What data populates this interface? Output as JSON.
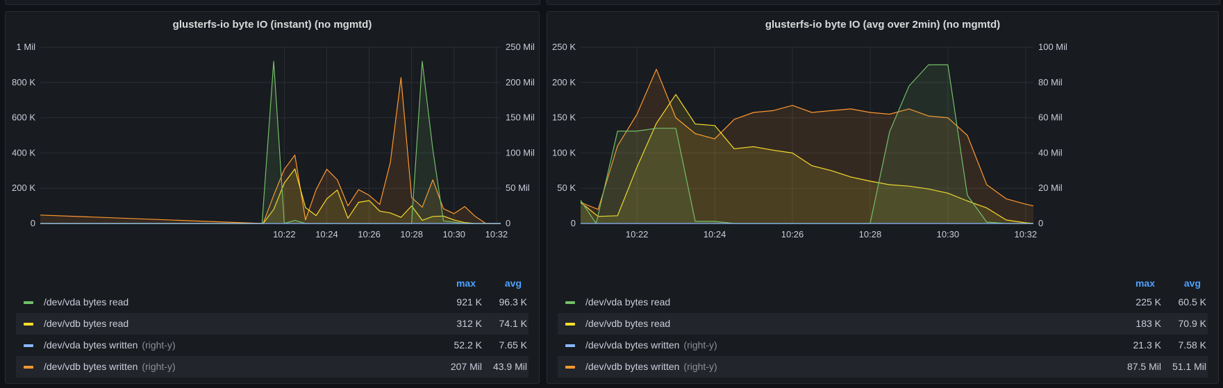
{
  "panels": [
    {
      "title": "glusterfs-io byte IO (instant) (no mgmtd)",
      "legend": {
        "max_header": "max",
        "avg_header": "avg",
        "rows": [
          {
            "name": "/dev/vda bytes read",
            "axis_note": "",
            "color": "#73bf69",
            "max": "921 K",
            "avg": "96.3 K"
          },
          {
            "name": "/dev/vdb bytes read",
            "axis_note": "",
            "color": "#fade2a",
            "max": "312 K",
            "avg": "74.1 K"
          },
          {
            "name": "/dev/vda bytes written",
            "axis_note": "(right-y)",
            "color": "#8ab8ff",
            "max": "52.2 K",
            "avg": "7.65 K"
          },
          {
            "name": "/dev/vdb bytes written",
            "axis_note": "(right-y)",
            "color": "#ff9830",
            "max": "207 Mil",
            "avg": "43.9 Mil"
          }
        ]
      }
    },
    {
      "title": "glusterfs-io byte IO (avg over 2min) (no mgmtd)",
      "legend": {
        "max_header": "max",
        "avg_header": "avg",
        "rows": [
          {
            "name": "/dev/vda bytes read",
            "axis_note": "",
            "color": "#73bf69",
            "max": "225 K",
            "avg": "60.5 K"
          },
          {
            "name": "/dev/vdb bytes read",
            "axis_note": "",
            "color": "#fade2a",
            "max": "183 K",
            "avg": "70.9 K"
          },
          {
            "name": "/dev/vda bytes written",
            "axis_note": "(right-y)",
            "color": "#8ab8ff",
            "max": "21.3 K",
            "avg": "7.58 K"
          },
          {
            "name": "/dev/vdb bytes written",
            "axis_note": "(right-y)",
            "color": "#ff9830",
            "max": "87.5 Mil",
            "avg": "51.1 Mil"
          }
        ]
      }
    }
  ],
  "chart_data": [
    {
      "type": "area",
      "title": "glusterfs-io byte IO (instant) (no mgmtd)",
      "x_unit": "minutes",
      "xlim": [
        10.5,
        32.2
      ],
      "x_ticks": [
        22,
        24,
        26,
        28,
        30,
        32
      ],
      "x_tick_labels": [
        "10:22",
        "10:24",
        "10:26",
        "10:28",
        "10:30",
        "10:32"
      ],
      "y_left": {
        "ylim": [
          0,
          1000000
        ],
        "ticks": [
          0,
          200000,
          400000,
          600000,
          800000,
          1000000
        ],
        "tick_labels": [
          "0",
          "200 K",
          "400 K",
          "600 K",
          "800 K",
          "1 Mil"
        ]
      },
      "y_right": {
        "ylim": [
          0,
          250000000
        ],
        "ticks": [
          0,
          50000000,
          100000000,
          150000000,
          200000000,
          250000000
        ],
        "tick_labels": [
          "0",
          "50 Mil",
          "100 Mil",
          "150 Mil",
          "200 Mil",
          "250 Mil"
        ]
      },
      "grid": true,
      "legend_position": "bottom",
      "series": [
        {
          "name": "/dev/vda bytes read",
          "axis": "left",
          "color": "#73bf69",
          "x": [
            10.5,
            20.95,
            21.5,
            22.0,
            22.5,
            23.0,
            27.0,
            28.0,
            28.5,
            29.0,
            29.5,
            30.5,
            32.2
          ],
          "y": [
            0,
            0,
            920000,
            0,
            18000,
            0,
            0,
            0,
            920000,
            420000,
            15000,
            0,
            0
          ]
        },
        {
          "name": "/dev/vdb bytes read",
          "axis": "left",
          "color": "#fade2a",
          "x": [
            10.5,
            21.0,
            21.5,
            22.0,
            22.5,
            23.0,
            23.5,
            24.0,
            24.5,
            25.0,
            25.5,
            26.0,
            26.5,
            27.0,
            27.5,
            28.0,
            28.5,
            29.0,
            29.5,
            30.0,
            30.5,
            31.0,
            31.5,
            32.2
          ],
          "y": [
            0,
            0,
            80000,
            230000,
            310000,
            90000,
            45000,
            140000,
            190000,
            30000,
            120000,
            130000,
            70000,
            60000,
            35000,
            100000,
            18000,
            40000,
            42000,
            20000,
            5000,
            0,
            0,
            0
          ]
        },
        {
          "name": "/dev/vda bytes written",
          "axis": "right",
          "color": "#8ab8ff",
          "x": [
            10.5,
            32.2
          ],
          "y": [
            20000,
            20000
          ]
        },
        {
          "name": "/dev/vdb bytes written",
          "axis": "right",
          "color": "#ff9830",
          "x": [
            10.5,
            21.0,
            21.5,
            22.0,
            22.5,
            23.0,
            23.5,
            24.0,
            24.5,
            25.0,
            25.5,
            26.0,
            26.5,
            27.0,
            27.5,
            28.0,
            28.5,
            29.0,
            29.5,
            30.0,
            30.5,
            31.0,
            31.5,
            32.0,
            32.2
          ],
          "y": [
            12000000,
            0,
            40000000,
            77000000,
            97000000,
            5000000,
            48000000,
            77000000,
            62000000,
            25000000,
            48000000,
            40000000,
            27000000,
            87000000,
            207000000,
            37000000,
            23000000,
            62000000,
            21000000,
            14000000,
            24000000,
            10000000,
            0,
            0,
            0
          ]
        }
      ]
    },
    {
      "type": "area",
      "title": "glusterfs-io byte IO (avg over 2min) (no mgmtd)",
      "x_unit": "minutes",
      "xlim": [
        20.55,
        32.2
      ],
      "x_ticks": [
        22,
        24,
        26,
        28,
        30,
        32
      ],
      "x_tick_labels": [
        "10:22",
        "10:24",
        "10:26",
        "10:28",
        "10:30",
        "10:32"
      ],
      "y_left": {
        "ylim": [
          0,
          250000
        ],
        "ticks": [
          0,
          50000,
          100000,
          150000,
          200000,
          250000
        ],
        "tick_labels": [
          "0",
          "50 K",
          "100 K",
          "150 K",
          "200 K",
          "250 K"
        ]
      },
      "y_right": {
        "ylim": [
          0,
          100000000
        ],
        "ticks": [
          0,
          20000000,
          40000000,
          60000000,
          80000000,
          100000000
        ],
        "tick_labels": [
          "0",
          "20 Mil",
          "40 Mil",
          "60 Mil",
          "80 Mil",
          "100 Mil"
        ]
      },
      "grid": true,
      "legend_position": "bottom",
      "series": [
        {
          "name": "/dev/vda bytes read",
          "axis": "left",
          "color": "#73bf69",
          "x": [
            20.55,
            20.95,
            21.5,
            22.0,
            22.5,
            23.0,
            23.5,
            24.0,
            24.5,
            28.0,
            28.5,
            29.0,
            29.5,
            30.0,
            30.5,
            31.0,
            31.5,
            32.2
          ],
          "y": [
            33000,
            0,
            131000,
            131000,
            135000,
            135000,
            3000,
            3000,
            0,
            0,
            130000,
            195000,
            225000,
            225000,
            40000,
            2000,
            0,
            0
          ]
        },
        {
          "name": "/dev/vdb bytes read",
          "axis": "left",
          "color": "#fade2a",
          "x": [
            20.55,
            21.0,
            21.5,
            22.0,
            22.5,
            23.0,
            23.5,
            24.0,
            24.5,
            25.0,
            25.5,
            26.0,
            26.5,
            27.0,
            27.5,
            28.0,
            28.5,
            29.0,
            29.5,
            30.0,
            30.5,
            31.0,
            31.5,
            32.0,
            32.2
          ],
          "y": [
            30000,
            10000,
            11000,
            80000,
            142000,
            183000,
            141000,
            139000,
            106000,
            109000,
            104000,
            100000,
            82000,
            75000,
            66000,
            60000,
            55000,
            53000,
            49000,
            43000,
            32000,
            22000,
            5000,
            1000,
            0
          ]
        },
        {
          "name": "/dev/vda bytes written",
          "axis": "right",
          "color": "#8ab8ff",
          "x": [
            20.55,
            32.2
          ],
          "y": [
            8000,
            8000
          ]
        },
        {
          "name": "/dev/vdb bytes written",
          "axis": "right",
          "color": "#ff9830",
          "x": [
            20.55,
            21.0,
            21.5,
            22.0,
            22.5,
            23.0,
            23.5,
            24.0,
            24.5,
            25.0,
            25.5,
            26.0,
            26.5,
            27.0,
            27.5,
            28.0,
            28.5,
            29.0,
            29.5,
            30.0,
            30.5,
            31.0,
            31.5,
            32.0,
            32.2
          ],
          "y": [
            12000000,
            8000000,
            44000000,
            62000000,
            87500000,
            60000000,
            51000000,
            48000000,
            59000000,
            63000000,
            64000000,
            67000000,
            63000000,
            64000000,
            65000000,
            63000000,
            62000000,
            65000000,
            61000000,
            60000000,
            50000000,
            22000000,
            14000000,
            11000000,
            10000000
          ]
        }
      ]
    }
  ]
}
